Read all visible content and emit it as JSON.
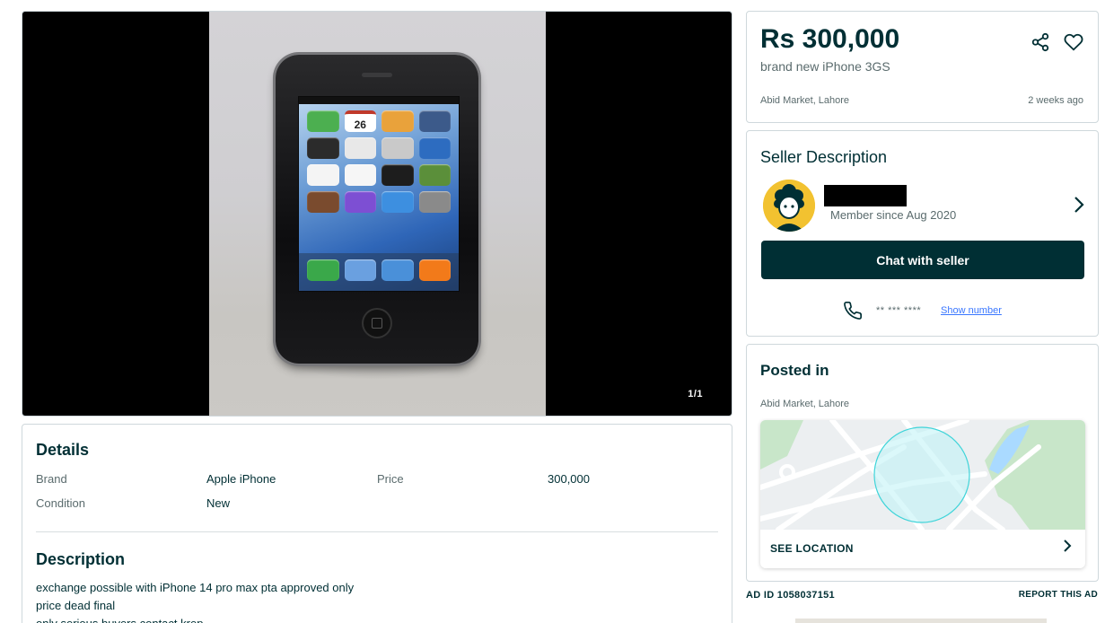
{
  "gallery": {
    "counter": "1/1",
    "phone_calendar_day": "26"
  },
  "listing": {
    "price": "Rs 300,000",
    "title": "brand new iPhone 3GS",
    "location": "Abid Market, Lahore",
    "posted_ago": "2 weeks ago"
  },
  "seller": {
    "heading": "Seller Description",
    "member_since": "Member since Aug 2020",
    "chat_label": "Chat with seller",
    "masked_phone": "** *** ****",
    "show_number_label": "Show number"
  },
  "details": {
    "heading": "Details",
    "rows": [
      {
        "label": "Brand",
        "value": "Apple iPhone"
      },
      {
        "label": "Price",
        "value": "300,000"
      },
      {
        "label": "Condition",
        "value": "New"
      }
    ]
  },
  "description": {
    "heading": "Description",
    "lines": [
      "exchange possible with iPhone 14 pro max pta approved only",
      "price dead final",
      "only serious buyers contact krep"
    ]
  },
  "posted": {
    "heading": "Posted in",
    "location": "Abid Market, Lahore",
    "see_location_label": "SEE LOCATION"
  },
  "footer": {
    "ad_id": "AD ID 1058037151",
    "report_label": "REPORT THIS AD"
  },
  "colors": {
    "brand_dark": "#002f34",
    "link_blue": "#3a77ff",
    "map_water": "#aadaff",
    "map_park": "#c8e6c9",
    "radius_fill": "#bdf3f5",
    "avatar_bg": "#f2c230"
  },
  "icons": {
    "share": "share-icon",
    "favorite": "heart-icon",
    "phone": "phone-icon",
    "chevron": "chevron-right-icon"
  }
}
